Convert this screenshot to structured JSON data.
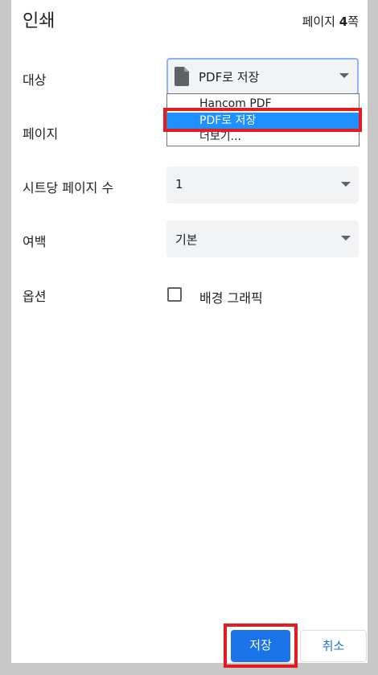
{
  "header": {
    "title": "인쇄",
    "page_prefix": "페이지 ",
    "page_count": "4",
    "page_suffix": "쪽"
  },
  "destination": {
    "label": "대상",
    "value": "PDF로 저장",
    "icon": "document-icon",
    "options": [
      "Hancom PDF",
      "PDF로 저장",
      "더보기..."
    ],
    "selected_option": "PDF로 저장"
  },
  "pages": {
    "label": "페이지"
  },
  "pages_per_sheet": {
    "label": "시트당 페이지 수",
    "value": "1"
  },
  "margins": {
    "label": "여백",
    "value": "기본"
  },
  "options": {
    "label": "옵션",
    "background_graphics_label": "배경 그래픽",
    "background_graphics_checked": false
  },
  "actions": {
    "save_label": "저장",
    "cancel_label": "취소"
  },
  "colors": {
    "primary": "#1a73e8",
    "highlight": "#e31b23",
    "selected_option_bg": "#1e90ff"
  }
}
